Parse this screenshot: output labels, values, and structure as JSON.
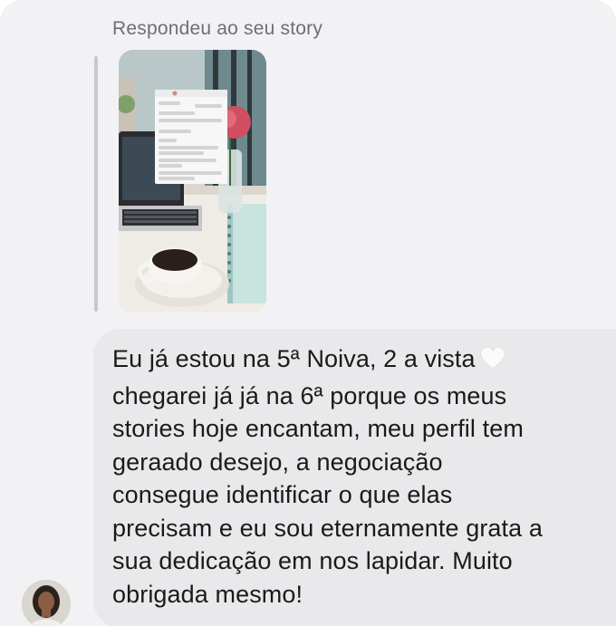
{
  "reply_header": {
    "label": "Respondeu ao seu story"
  },
  "story": {
    "description_icon": "story-thumbnail-icon"
  },
  "message": {
    "lines": [
      "Eu já estou na 5ª Noiva, 2 a vista",
      "chegarei já já na 6ª porque os meus",
      "stories hoje encantam, meu perfil tem",
      "geraado desejo, a negociação",
      "consegue identificar o que elas",
      "precisam e eu sou eternamente grata a",
      "sua dedicação em nos lapidar. Muito",
      "obrigada mesmo!"
    ],
    "emoji": "🤍"
  },
  "colors": {
    "background": "#f2f2f4",
    "bubble": "#e9e9ec",
    "label": "#6f6f73",
    "text": "#1a1a1a"
  }
}
